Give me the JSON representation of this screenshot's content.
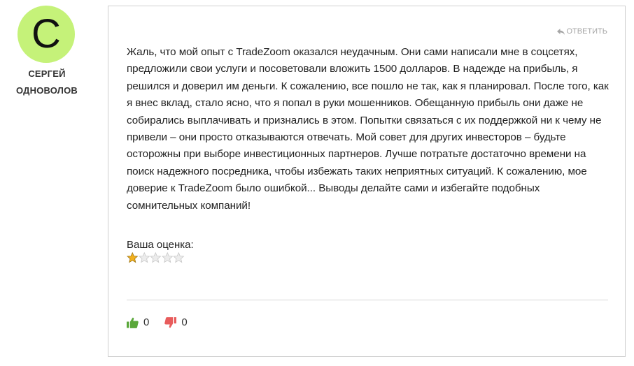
{
  "author": {
    "avatar_letter": "С",
    "avatar_color": "#c5f279",
    "first_name": "СЕРГЕЙ",
    "last_name": "ОДНОВОЛОВ"
  },
  "review": {
    "reply_label": "ОТВЕТИТЬ",
    "text": "Жаль, что мой опыт с TradeZoom оказался неудачным. Они сами написали мне в соцсетях, предложили свои услуги и посоветовали вложить 1500 долларов. В надежде на прибыль, я решился и доверил им деньги. К сожалению, все пошло не так, как я планировал. После того, как я внес вклад, стало ясно, что я попал в руки мошенников. Обещанную прибыль они даже не собирались выплачивать и признались в этом. Попытки связаться с их поддержкой ни к чему не привели – они просто отказываются отвечать. Мой совет для других инвесторов – будьте осторожны при выборе инвестиционных партнеров. Лучше потратьте достаточно времени на поиск надежного посредника, чтобы избежать таких неприятных ситуаций. К сожалению, мое доверие к TradeZoom было ошибкой... Выводы делайте сами и избегайте подобных сомнительных компаний!",
    "rating_label": "Ваша оценка:",
    "rating": 1,
    "rating_max": 5,
    "star_color": "#f2b01e",
    "likes": "0",
    "dislikes": "0",
    "like_color": "#5aa73a",
    "dislike_color": "#e85c5c"
  }
}
